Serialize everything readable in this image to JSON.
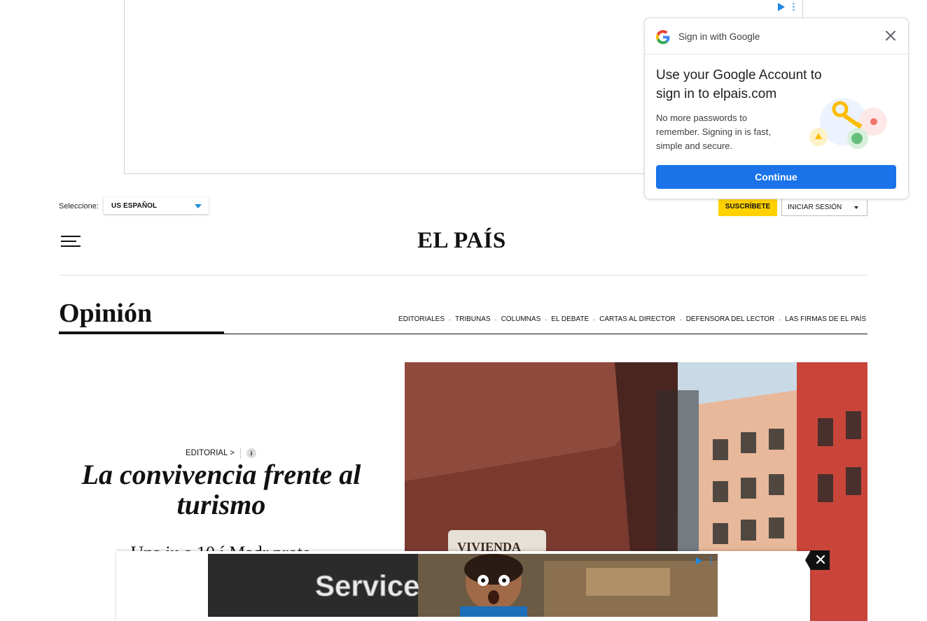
{
  "colors": {
    "subscribe_bg": "#ffd100",
    "google_blue": "#1a73e8",
    "edition_caret": "#1a8fd8",
    "text": "#111111"
  },
  "header": {
    "edition_label": "Seleccione:",
    "edition_value": "US ESPAÑOL",
    "subscribe_label": "SUSCRÍBETE",
    "login_label": "INICIAR SESIÓN",
    "logo_text": "EL PAÍS",
    "menu_icon": "hamburger-menu-icon"
  },
  "section": {
    "title": "Opinión",
    "nav": [
      "EDITORIALES",
      "TRIBUNAS",
      "COLUMNAS",
      "EL DEBATE",
      "CARTAS AL DIRECTOR",
      "DEFENSORA DEL LECTOR",
      "LAS FIRMAS DE EL PAÍS"
    ],
    "nav_separator": "·"
  },
  "article": {
    "kicker": "EDITORIAL >",
    "info_icon_text": "i",
    "headline": "La convivencia frente al turismo",
    "standfirst": "Una ju         a  10           í       Madr           prote",
    "photo_sign_text": "VIVIENDA"
  },
  "google_signin": {
    "header": "Sign in with Google",
    "title": "Use your Google Account to sign in to elpais.com",
    "body": "No more passwords to remember. Signing in is fast, simple and secure.",
    "button": "Continue",
    "icons": [
      "google-logo-icon",
      "close-icon",
      "key-illustration-icon"
    ]
  },
  "bottom_ad": {
    "creative_text": "Service",
    "close_icon": "close-icon"
  }
}
